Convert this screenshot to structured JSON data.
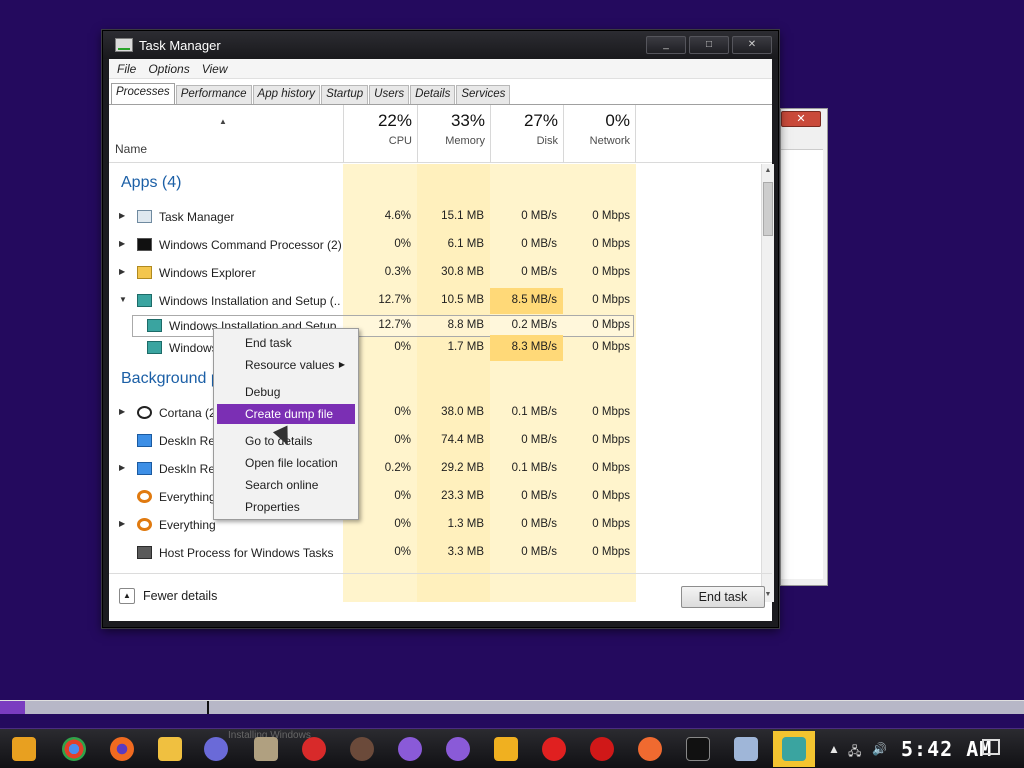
{
  "window": {
    "title": "Task Manager",
    "controls": {
      "minimize": "_",
      "maximize": "□",
      "close": "✕"
    }
  },
  "menu": [
    "File",
    "Options",
    "View"
  ],
  "tabs": [
    "Processes",
    "Performance",
    "App history",
    "Startup",
    "Users",
    "Details",
    "Services"
  ],
  "header": {
    "name": "Name",
    "columns": [
      {
        "pct": "22%",
        "label": "CPU"
      },
      {
        "pct": "33%",
        "label": "Memory"
      },
      {
        "pct": "27%",
        "label": "Disk"
      },
      {
        "pct": "0%",
        "label": "Network"
      }
    ]
  },
  "groups": {
    "apps": "Apps (4)",
    "background": "Background p"
  },
  "rows": [
    {
      "name": "Task Manager",
      "icon": "task-manager-icon",
      "expand": "▶",
      "cpu": "4.6%",
      "mem": "15.1 MB",
      "disk": "0 MB/s",
      "net": "0 Mbps"
    },
    {
      "name": "Windows Command Processor (2)",
      "icon": "cmd-icon",
      "expand": "▶",
      "cpu": "0%",
      "mem": "6.1 MB",
      "disk": "0 MB/s",
      "net": "0 Mbps"
    },
    {
      "name": "Windows Explorer",
      "icon": "explorer-icon",
      "expand": "▶",
      "cpu": "0.3%",
      "mem": "30.8 MB",
      "disk": "0 MB/s",
      "net": "0 Mbps"
    },
    {
      "name": "Windows Installation and Setup (...",
      "icon": "setup-icon",
      "expand": "▼",
      "cpu": "12.7%",
      "mem": "10.5 MB",
      "disk": "8.5 MB/s",
      "net": "0 Mbps"
    },
    {
      "name": "Windows Installation and Setup",
      "icon": "setup-icon",
      "expand": "",
      "cpu": "12.7%",
      "mem": "8.8 MB",
      "disk": "0.2 MB/s",
      "net": "0 Mbps"
    },
    {
      "name": "Windows",
      "icon": "setup-icon",
      "expand": "",
      "cpu": "0%",
      "mem": "1.7 MB",
      "disk": "8.3 MB/s",
      "net": "0 Mbps"
    },
    {
      "name": "Cortana (2",
      "icon": "cortana-icon",
      "expand": "▶",
      "cpu": "0%",
      "mem": "38.0 MB",
      "disk": "0.1 MB/s",
      "net": "0 Mbps"
    },
    {
      "name": "DeskIn Re",
      "icon": "deskin-icon",
      "expand": "",
      "cpu": "0%",
      "mem": "74.4 MB",
      "disk": "0 MB/s",
      "net": "0 Mbps"
    },
    {
      "name": "DeskIn Re",
      "icon": "deskin-icon",
      "expand": "▶",
      "cpu": "0.2%",
      "mem": "29.2 MB",
      "disk": "0.1 MB/s",
      "net": "0 Mbps"
    },
    {
      "name": "Everything",
      "icon": "everything-icon",
      "expand": "",
      "cpu": "0%",
      "mem": "23.3 MB",
      "disk": "0 MB/s",
      "net": "0 Mbps"
    },
    {
      "name": "Everything",
      "icon": "everything-icon",
      "expand": "▶",
      "cpu": "0%",
      "mem": "1.3 MB",
      "disk": "0 MB/s",
      "net": "0 Mbps"
    },
    {
      "name": "Host Process for Windows Tasks",
      "icon": "host-process-icon",
      "expand": "",
      "cpu": "0%",
      "mem": "3.3 MB",
      "disk": "0 MB/s",
      "net": "0 Mbps"
    }
  ],
  "context_menu": {
    "items": [
      "End task",
      "Resource values",
      "Debug",
      "Create dump file",
      "Go to details",
      "Open file location",
      "Search online",
      "Properties"
    ],
    "submenu_arrow": "▶",
    "highlighted": "Create dump file"
  },
  "footer": {
    "fewer_details": "Fewer details",
    "fewer_icon": "▲",
    "end_task": "End task"
  },
  "background_window": {
    "close": "✕"
  },
  "progress": {
    "fraction": 0.024
  },
  "taskbar": {
    "faint_label": "Installing Windows",
    "clock": "5:42 AM",
    "tray": [
      "▲",
      "🖧",
      "🔊"
    ]
  },
  "colors": {
    "desktop": "#240a5e",
    "accent": "#7b2fb4",
    "heat_light": "#fff4cc",
    "heat_medium": "#ffe9a8",
    "group_title": "#1b5fa6"
  }
}
